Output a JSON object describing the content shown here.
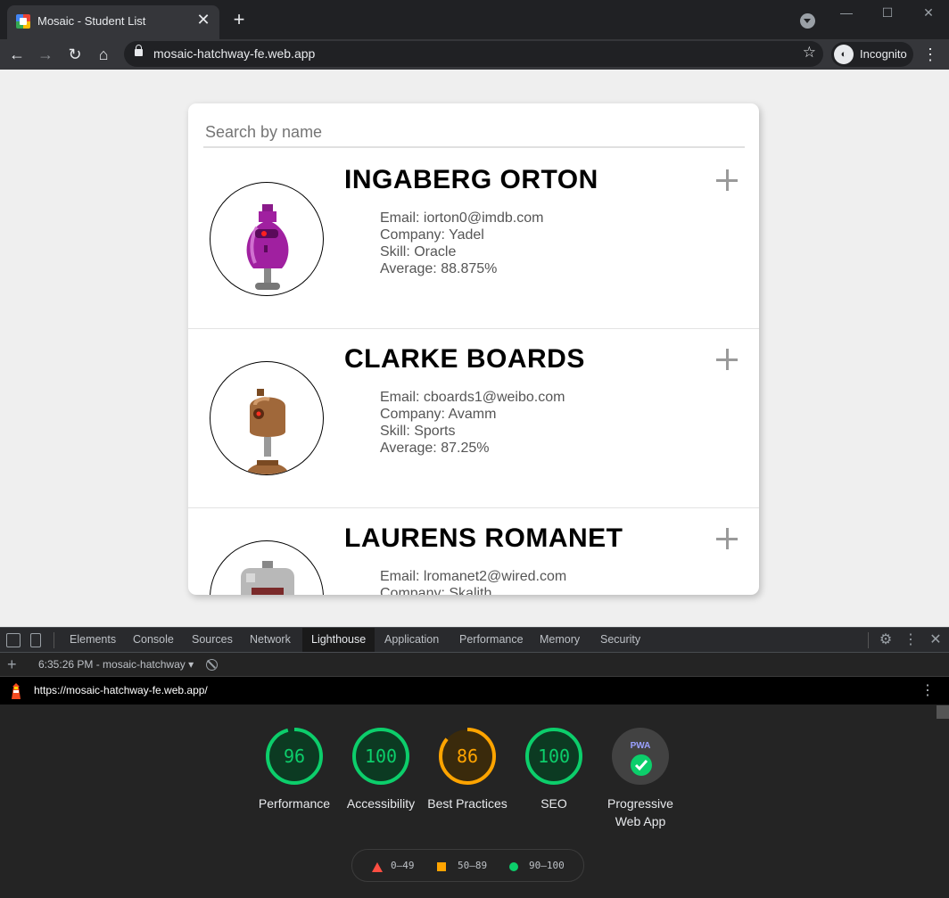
{
  "browser": {
    "tab_title": "Mosaic - Student List",
    "url": "mosaic-hatchway-fe.web.app",
    "profile_label": "Incognito"
  },
  "search": {
    "placeholder": "Search by name"
  },
  "students": [
    {
      "name": "INGABERG ORTON",
      "email": "Email: iorton0@imdb.com",
      "company": "Company: Yadel",
      "skill": "Skill: Oracle",
      "average": "Average: 88.875%",
      "avatar_color": "#a020a0"
    },
    {
      "name": "CLARKE BOARDS",
      "email": "Email: cboards1@weibo.com",
      "company": "Company: Avamm",
      "skill": "Skill: Sports",
      "average": "Average: 87.25%",
      "avatar_color": "#a0683a"
    },
    {
      "name": "LAURENS ROMANET",
      "email": "Email: lromanet2@wired.com",
      "company": "Company: Skalith",
      "skill": "",
      "average": "",
      "avatar_color": "#b8b8b8"
    }
  ],
  "devtools": {
    "tabs": [
      "Elements",
      "Console",
      "Sources",
      "Network",
      "Lighthouse",
      "Application",
      "Performance",
      "Memory",
      "Security"
    ],
    "active_tab": "Lighthouse",
    "report_selector": "6:35:26 PM - mosaic-hatchway",
    "lighthouse_url": "https://mosaic-hatchway-fe.web.app/"
  },
  "lighthouse": {
    "scores": [
      {
        "value": 96,
        "label": "Performance",
        "color": "#0cce6b",
        "bg": "#0c3a22"
      },
      {
        "value": 100,
        "label": "Accessibility",
        "color": "#0cce6b",
        "bg": "#0c3a22"
      },
      {
        "value": 86,
        "label": "Best Practices",
        "color": "#ffa400",
        "bg": "#3a2a0c"
      },
      {
        "value": 100,
        "label": "SEO",
        "color": "#0cce6b",
        "bg": "#0c3a22"
      }
    ],
    "pwa": {
      "label": "Progressive Web App",
      "badge_text": "PWA"
    },
    "legend": [
      {
        "range": "0–49",
        "color": "#ff4e42",
        "shape": "triangle"
      },
      {
        "range": "50–89",
        "color": "#ffa400",
        "shape": "square"
      },
      {
        "range": "90–100",
        "color": "#0cce6b",
        "shape": "circle"
      }
    ]
  }
}
